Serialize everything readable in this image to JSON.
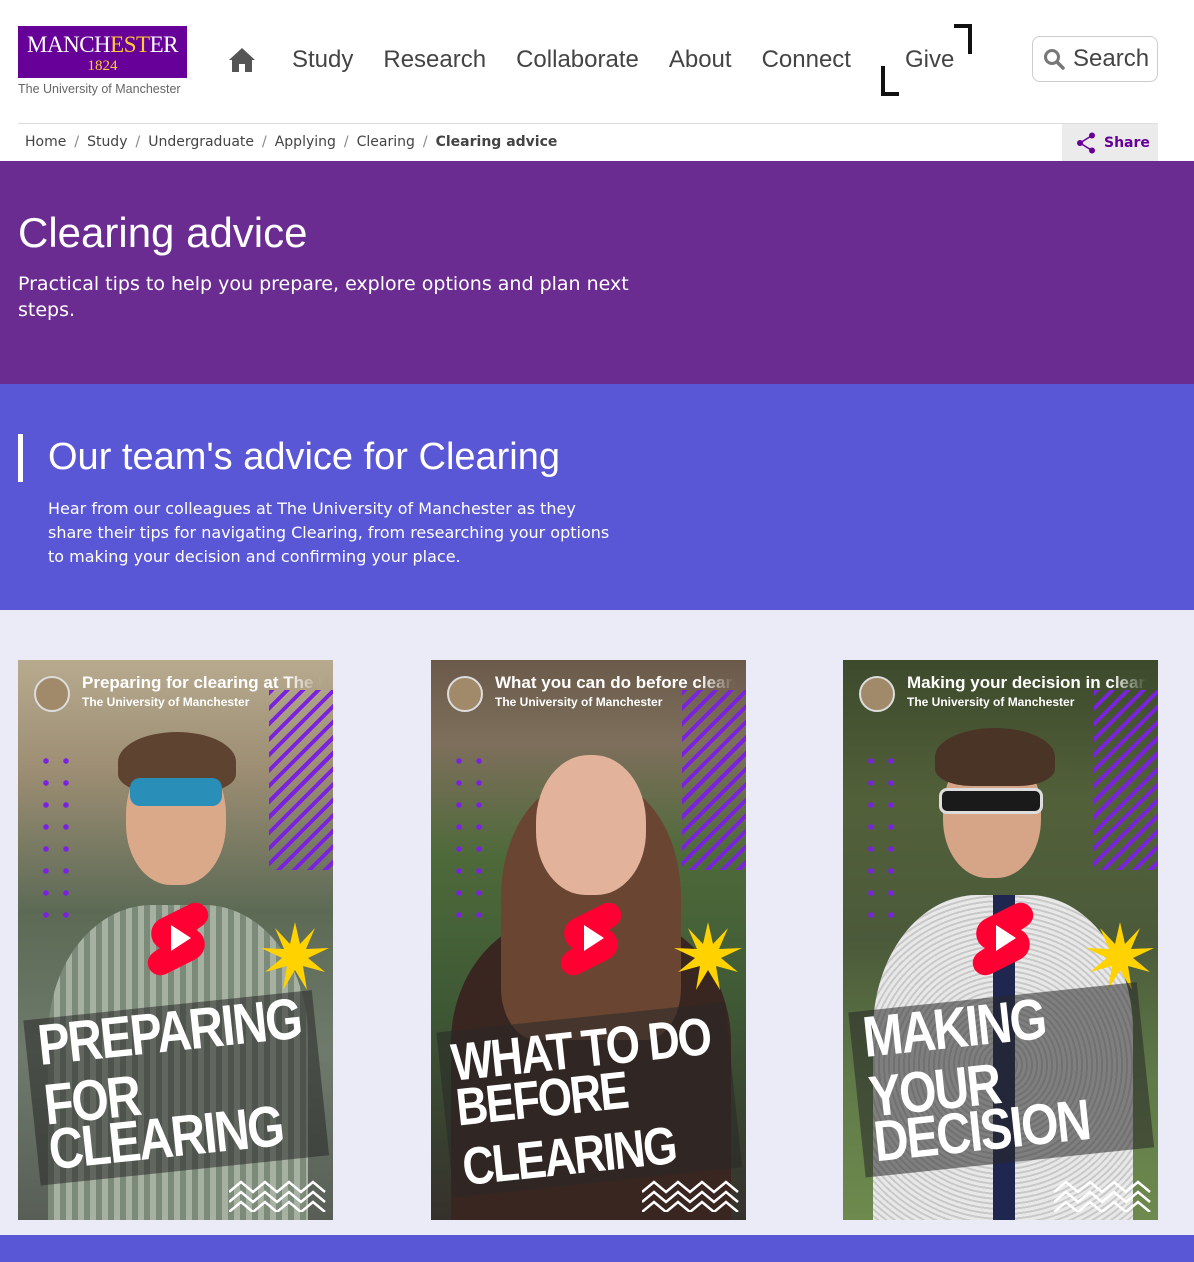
{
  "logo": {
    "word_part1": "MANCH",
    "word_part2": "EST",
    "word_part3": "ER",
    "year": "1824",
    "subtitle": "The University of Manchester"
  },
  "nav": {
    "home_icon": "home-icon",
    "items": [
      "Study",
      "Research",
      "Collaborate",
      "About",
      "Connect"
    ],
    "give": "Give",
    "search": "Search"
  },
  "breadcrumb": {
    "items": [
      "Home",
      "Study",
      "Undergraduate",
      "Applying",
      "Clearing"
    ],
    "current": "Clearing advice",
    "separator": "/"
  },
  "share": {
    "label": "Share"
  },
  "hero": {
    "title": "Clearing advice",
    "subtitle": "Practical tips to help you prepare, explore options and plan next steps."
  },
  "advice": {
    "title": "Our team's advice for Clearing",
    "text": "Hear from our colleagues at The University of Manchester as they share their tips for navigating Clearing, from researching your options to making your decision and confirming your place."
  },
  "videos": [
    {
      "title": "Preparing for clearing at The University of Manchester",
      "channel": "The University of Manchester",
      "caption_line1": "PREPARING FOR",
      "caption_line2": "CLEARING"
    },
    {
      "title": "What you can do before clearing",
      "channel": "The University of Manchester",
      "caption_line1": "WHAT TO DO",
      "caption_line2": "BEFORE CLEARING"
    },
    {
      "title": "Making your decision in clearing",
      "channel": "The University of Manchester",
      "caption_line1": "MAKING YOUR",
      "caption_line2": "DECISION"
    }
  ],
  "colors": {
    "brand_purple": "#660099",
    "hero_bg": "#6b2c91",
    "advice_bg": "#5a57d6",
    "video_section_bg": "#ebeaf7",
    "gold": "#ffcc33"
  }
}
